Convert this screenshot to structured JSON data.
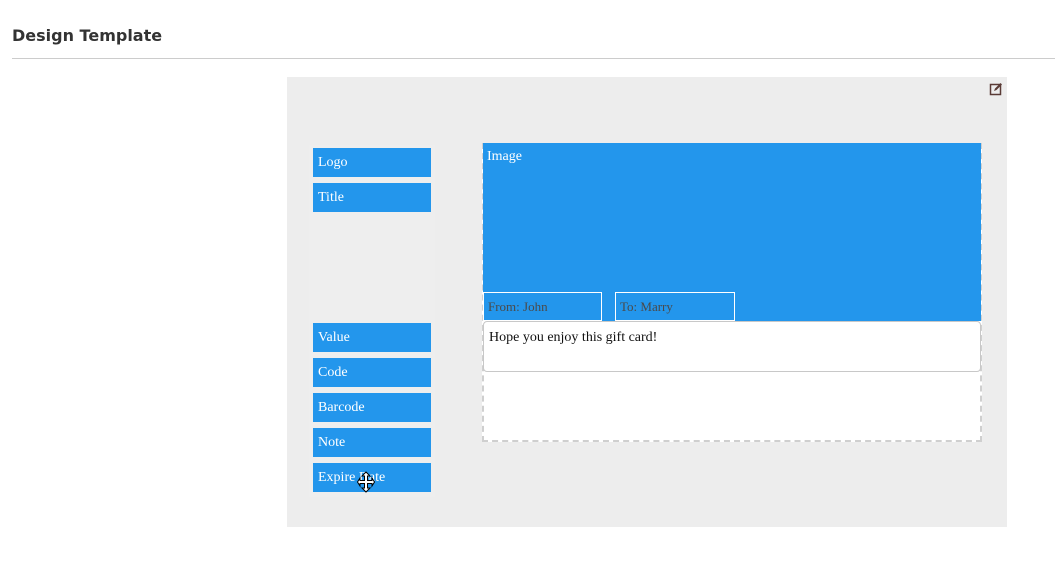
{
  "section": {
    "title": "Design Template"
  },
  "toolbar": {
    "edit_icon": "edit-icon"
  },
  "fields": [
    {
      "label": "Logo"
    },
    {
      "label": "Title"
    },
    {
      "label": "Value"
    },
    {
      "label": "Code"
    },
    {
      "label": "Barcode"
    },
    {
      "label": "Note"
    },
    {
      "label": "Expire Date"
    }
  ],
  "card": {
    "image_label": "Image",
    "from_text": "From: John",
    "to_text": "To: Marry",
    "message": "Hope you enjoy this gift card!"
  },
  "colors": {
    "field_blue": "#2396ec",
    "canvas_gray": "#ededed",
    "dashed_border": "#cfcfcf"
  }
}
